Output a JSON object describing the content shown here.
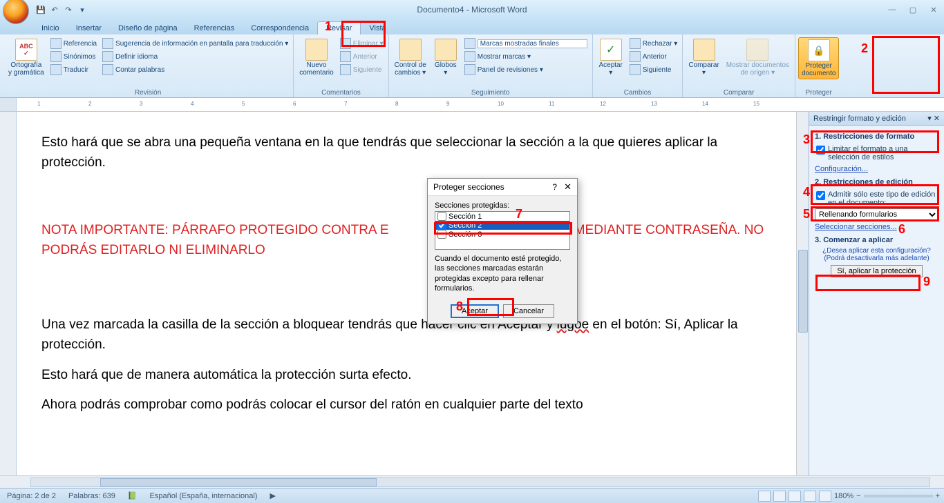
{
  "title": "Documento4 - Microsoft Word",
  "tabs": [
    "Inicio",
    "Insertar",
    "Diseño de página",
    "Referencias",
    "Correspondencia",
    "Revisar",
    "Vista"
  ],
  "active_tab": 5,
  "ribbon": {
    "revision": {
      "label": "Revisión",
      "ortografia": "Ortografía\ny gramática",
      "referencia": "Referencia",
      "sinonimos": "Sinónimos",
      "traducir": "Traducir",
      "sugerencia": "Sugerencia de información en pantalla para traducción ▾",
      "definir": "Definir idioma",
      "contar": "Contar palabras"
    },
    "comentarios": {
      "label": "Comentarios",
      "nuevo": "Nuevo\ncomentario",
      "eliminar": "Eliminar ▾",
      "anterior": "Anterior",
      "siguiente": "Siguiente"
    },
    "seguimiento": {
      "label": "Seguimiento",
      "control": "Control de\ncambios ▾",
      "globos": "Globos\n▾",
      "marcas_finales": "Marcas mostradas finales",
      "mostrar_marcas": "Mostrar marcas ▾",
      "panel": "Panel de revisiones ▾"
    },
    "cambios": {
      "label": "Cambios",
      "aceptar": "Aceptar\n▾",
      "rechazar": "Rechazar ▾",
      "anterior": "Anterior",
      "siguiente": "Siguiente"
    },
    "comparar": {
      "label": "Comparar",
      "comparar": "Comparar\n▾",
      "mostrar_docs": "Mostrar documentos\nde origen ▾"
    },
    "proteger": {
      "label": "Proteger",
      "proteger_doc": "Proteger\ndocumento"
    }
  },
  "document": {
    "p1": "Esto hará que se abra una pequeña ventana en la que tendrás que seleccionar la sección a la que quieres aplicar la protección.",
    "p2_a": "NOTA IMPORTANTE: PÁRRAFO PROTEGIDO CONTRA E",
    "p2_b": "CIÓN MEDIANTE CONTRASEÑA. NO PODRÁS EDITARLO NI ELIMINARLO",
    "p3_a": "Una vez marcada la casilla de la sección a bloquear tendrás que hacer clic en Aceptar y ",
    "p3_wavy": "lugoe",
    "p3_b": " en el botón: Sí, Aplicar la protección.",
    "p4": "Esto hará que de manera automática la protección surta efecto.",
    "p5": "Ahora podrás comprobar como podrás colocar el cursor del ratón en cualquier parte del texto"
  },
  "dialog": {
    "title": "Proteger secciones",
    "label": "Secciones protegidas:",
    "items": [
      "Sección 1",
      "Sección 2",
      "Sección 3"
    ],
    "checked": [
      false,
      true,
      false
    ],
    "selected": 1,
    "note": "Cuando el documento esté protegido, las secciones marcadas estarán protegidas excepto para rellenar formularios.",
    "ok": "Aceptar",
    "cancel": "Cancelar"
  },
  "pane": {
    "title": "Restringir formato y edición",
    "s1_title": "1. Restricciones de formato",
    "s1_check": "Limitar el formato a una selección de estilos",
    "s1_link": "Configuración...",
    "s2_title": "2. Restricciones de edición",
    "s2_check": "Admitir sólo este tipo de edición en el documento:",
    "s2_select": "Rellenando formularios",
    "s2_link": "Seleccionar secciones...",
    "s3_title": "3. Comenzar a aplicar",
    "s3_q": "¿Desea aplicar esta configuración? (Podrá desactivarla más adelante)",
    "s3_btn": "Sí, aplicar la protección"
  },
  "status": {
    "page": "Página: 2 de 2",
    "words": "Palabras: 639",
    "lang": "Español (España, internacional)",
    "zoom": "180%"
  },
  "ruler_marks": [
    "1",
    "2",
    "3",
    "4",
    "5",
    "6",
    "7",
    "8",
    "9",
    "10",
    "11",
    "12",
    "13",
    "14",
    "15"
  ],
  "annotations": [
    "1",
    "2",
    "3",
    "4",
    "5",
    "6",
    "7",
    "8",
    "9"
  ]
}
